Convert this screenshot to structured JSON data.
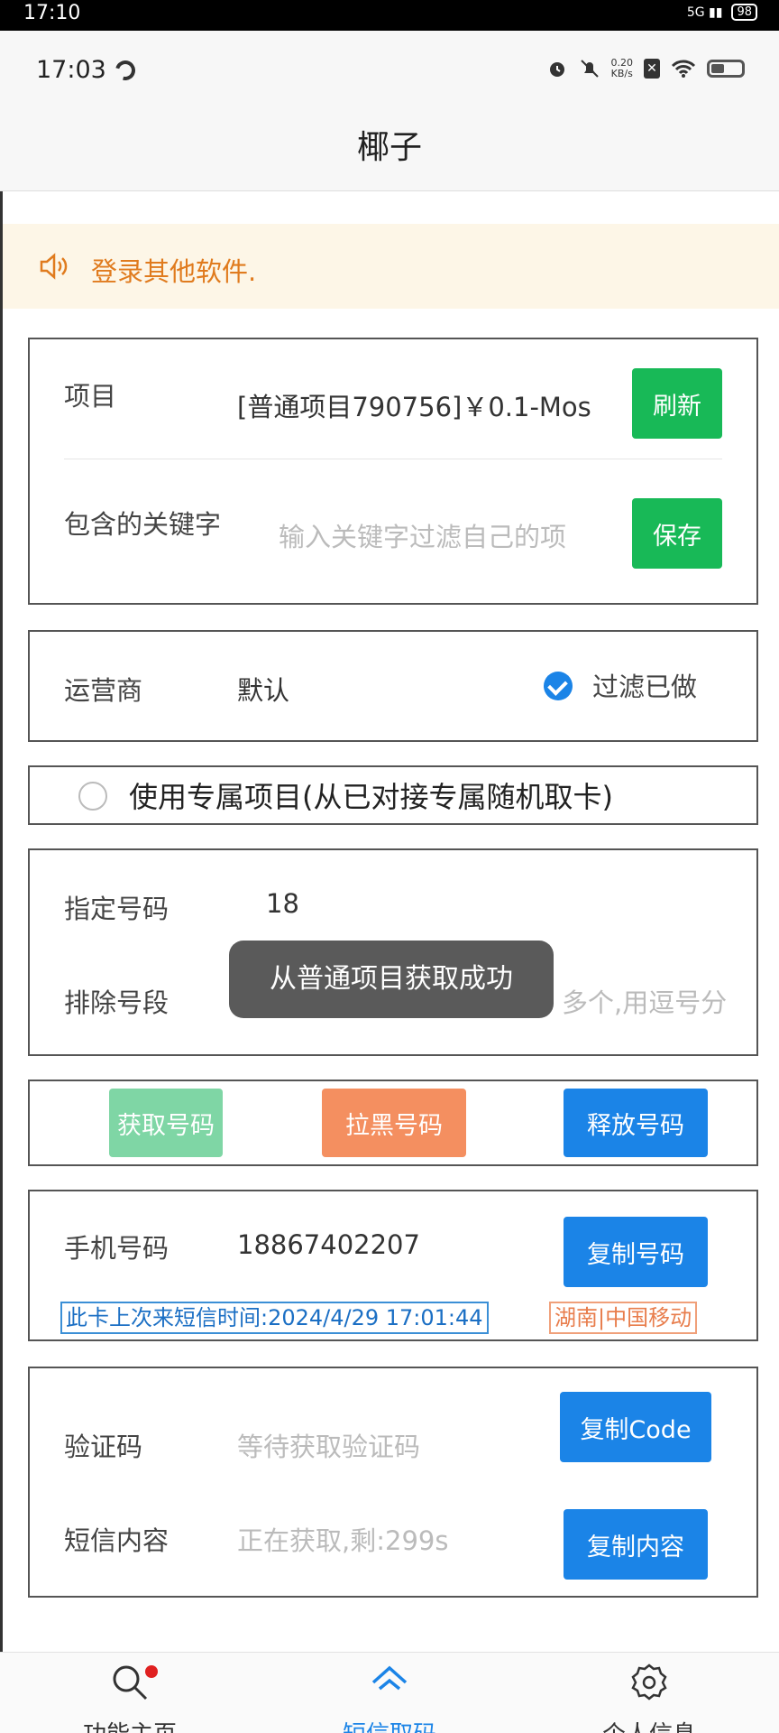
{
  "outer_status": {
    "time": "17:10",
    "battery": "98"
  },
  "status_bar": {
    "time": "17:03",
    "speed_value": "0.20",
    "speed_unit": "KB/s"
  },
  "header": {
    "title": "椰子"
  },
  "notice": {
    "text": "登录其他软件."
  },
  "project_card": {
    "project_label": "项目",
    "project_value": "[普通项目790756]￥0.1-Mos",
    "refresh_button": "刷新",
    "keyword_label": "包含的关键字",
    "keyword_placeholder": "输入关键字过滤自己的项",
    "save_button": "保存"
  },
  "operator_card": {
    "label": "运营商",
    "value": "默认",
    "filter_label": "过滤已做",
    "filter_checked": true
  },
  "exclusive": {
    "label": "使用专属项目(从已对接专属随机取卡)",
    "checked": false
  },
  "number_card": {
    "specified_label": "指定号码",
    "specified_value": "18",
    "exclude_label": "排除号段",
    "exclude_placeholder": "多个,用逗号分"
  },
  "actions": {
    "get_number": "获取号码",
    "blacklist_number": "拉黑号码",
    "release_number": "释放号码"
  },
  "phone_card": {
    "label": "手机号码",
    "value": "18867402207",
    "copy_button": "复制号码",
    "last_sms_tag": "此卡上次来短信时间:2024/4/29 17:01:44",
    "carrier_tag": "湖南|中国移动"
  },
  "sms_card": {
    "code_label": "验证码",
    "code_placeholder": "等待获取验证码",
    "copy_code_button": "复制Code",
    "content_label": "短信内容",
    "content_status": "正在获取,剩:299s",
    "copy_content_button": "复制内容"
  },
  "toast": {
    "text": "从普通项目获取成功"
  },
  "tabs": [
    {
      "label": "功能主页",
      "icon": "search-icon",
      "badge": true
    },
    {
      "label": "短信取码",
      "icon": "home-icon",
      "active": true
    },
    {
      "label": "个人信息",
      "icon": "gear-icon"
    }
  ],
  "colors": {
    "green": "#18b957",
    "orange": "#f48f60",
    "blue": "#1b84e7",
    "notice_text": "#e07b1e"
  }
}
